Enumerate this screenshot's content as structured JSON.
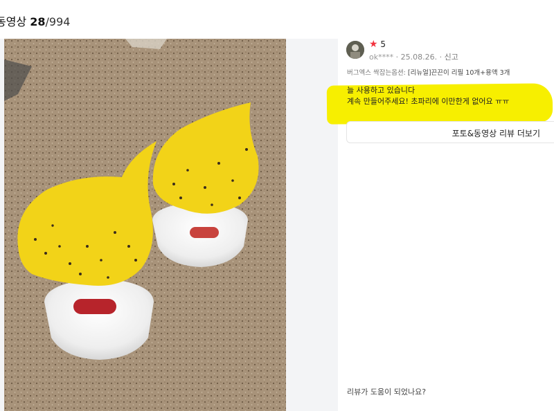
{
  "header": {
    "label": "동영상",
    "current": "28",
    "total": "/994"
  },
  "review": {
    "rating": "5",
    "nickname": "ok****",
    "date": "25.08.26.",
    "report_label": "신고",
    "option_label": "버그엑스 싹잡는",
    "option_key": "옵션:",
    "option_value": "[리뉴얼]끈끈이 리필 10개+용액 3개",
    "text_line1": "늘 사용하고 있습니다",
    "text_line2": "계속 만들어주세요! 초파리에 이만한게 없어요 ㅠㅠ",
    "highlight_color": "#f7ef00",
    "star_color": "#f2333f"
  },
  "more_button": {
    "label": "포토&동영상 리뷰 더보기"
  },
  "helpful": {
    "question": "리뷰가 도움이 되었나요?"
  },
  "photo": {
    "subject": "yellow-sticky-fly-trap-photo"
  }
}
